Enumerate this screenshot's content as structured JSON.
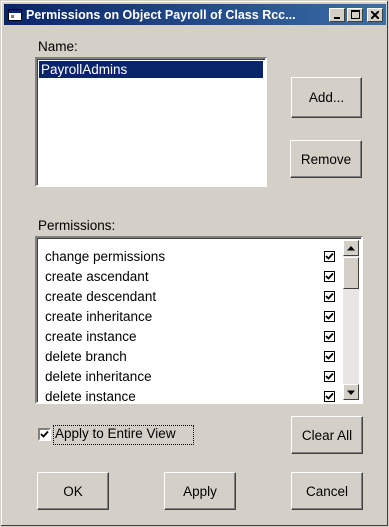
{
  "window": {
    "title": "Permissions on Object Payroll of Class Rcc...",
    "minimize_glyph": "_",
    "maximize_glyph": "□",
    "close_glyph": "×"
  },
  "name_section": {
    "label": "Name:",
    "items": [
      "PayrollAdmins"
    ],
    "selected_index": 0
  },
  "buttons": {
    "add": "Add...",
    "remove": "Remove",
    "clear_all": "Clear All",
    "ok": "OK",
    "apply": "Apply",
    "cancel": "Cancel"
  },
  "permissions": {
    "label": "Permissions:",
    "items": [
      {
        "label": "change permissions",
        "checked": true
      },
      {
        "label": "create ascendant",
        "checked": true
      },
      {
        "label": "create descendant",
        "checked": true
      },
      {
        "label": "create inheritance",
        "checked": true
      },
      {
        "label": "create instance",
        "checked": true
      },
      {
        "label": "delete branch",
        "checked": true
      },
      {
        "label": "delete inheritance",
        "checked": true
      },
      {
        "label": "delete instance",
        "checked": true
      }
    ]
  },
  "apply_entire_view": {
    "label": "Apply to Entire View",
    "checked": true
  },
  "colors": {
    "face": "#d4d0c8",
    "title_start": "#0a246a",
    "title_end": "#3a6ea5",
    "selection": "#0a246a"
  }
}
